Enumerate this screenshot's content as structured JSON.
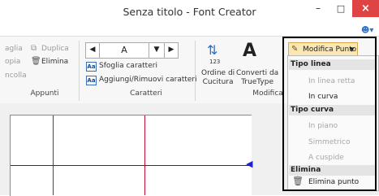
{
  "window": {
    "title": "Senza titolo - Font Creator",
    "minimize": "–",
    "maximize": "□",
    "close": "×"
  },
  "ribbon": {
    "clipboard": {
      "items": [
        "aglia",
        "Duplica",
        "opia",
        "Elimina",
        "ncolla"
      ],
      "label": "Appunti"
    },
    "chars": {
      "current_char": "A",
      "browse": "Sfoglia caratteri",
      "add_remove": "Aggiungi/Rimuovi caratteri",
      "label": "Caratteri"
    },
    "modify": {
      "seam_order": "Ordine di\nCucitura",
      "convert_tt": "Converti da\nTrueType",
      "label": "Modifica"
    }
  },
  "dropdown": {
    "trigger": "Modifica Punto",
    "sections": [
      {
        "header": "Tipo linea",
        "items": [
          {
            "label": "In linea retta",
            "enabled": false
          },
          {
            "label": "In curva",
            "enabled": true
          }
        ]
      },
      {
        "header": "Tipo curva",
        "items": [
          {
            "label": "In piano",
            "enabled": false
          },
          {
            "label": "Simmetrico",
            "enabled": false
          },
          {
            "label": "A cuspide",
            "enabled": false
          }
        ]
      },
      {
        "header": "Elimina",
        "items": [
          {
            "label": "Elimina punto",
            "enabled": true
          }
        ]
      }
    ]
  }
}
